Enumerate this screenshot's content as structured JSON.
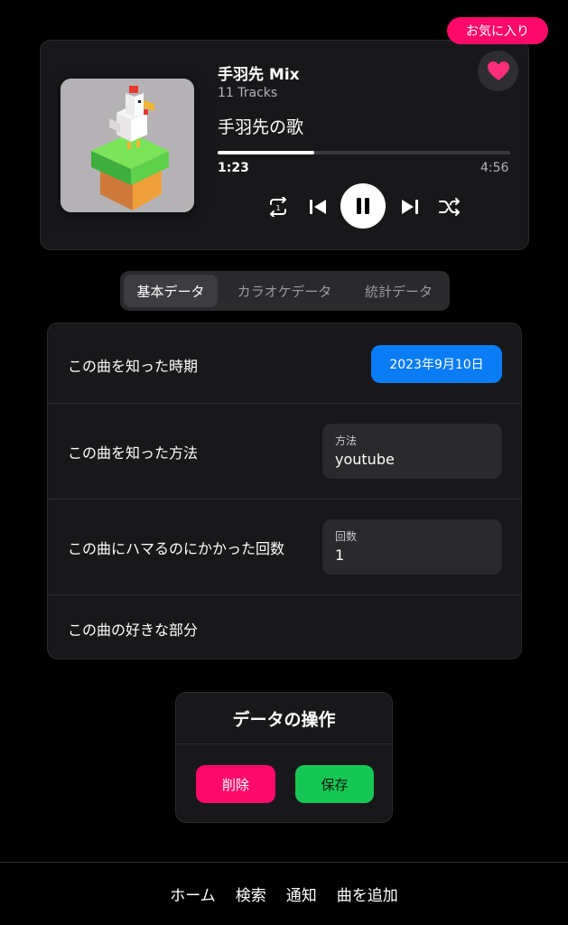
{
  "favorite_badge": "お気に入り",
  "player": {
    "playlist_title": "手羽先 Mix",
    "track_count": "11 Tracks",
    "song_title": "手羽先の歌",
    "current_time": "1:23",
    "total_time": "4:56",
    "progress": 0.33,
    "icons": {
      "favorite": "heart-icon",
      "repeat": "repeat-one-icon",
      "previous": "skip-previous-icon",
      "play_pause": "pause-icon",
      "next": "skip-next-icon",
      "shuffle": "shuffle-icon"
    }
  },
  "tabs": [
    {
      "label": "基本データ",
      "active": true
    },
    {
      "label": "カラオケデータ",
      "active": false
    },
    {
      "label": "統計データ",
      "active": false
    }
  ],
  "rows": {
    "known_date": {
      "label": "この曲を知った時期",
      "value": "2023年9月10日"
    },
    "known_method": {
      "label": "この曲を知った方法",
      "field_label": "方法",
      "value": "youtube"
    },
    "hooked_count": {
      "label": "この曲にハマるのにかかった回数",
      "field_label": "回数",
      "value": "1"
    },
    "favorite_part": {
      "label": "この曲の好きな部分"
    }
  },
  "operations": {
    "title": "データの操作",
    "delete_label": "削除",
    "save_label": "保存"
  },
  "nav": [
    "ホーム",
    "検索",
    "通知",
    "曲を追加"
  ],
  "colors": {
    "accent_pink": "#ff0a6a",
    "accent_blue": "#0a7cf5",
    "accent_green": "#16c655",
    "card_bg": "#18181b"
  }
}
